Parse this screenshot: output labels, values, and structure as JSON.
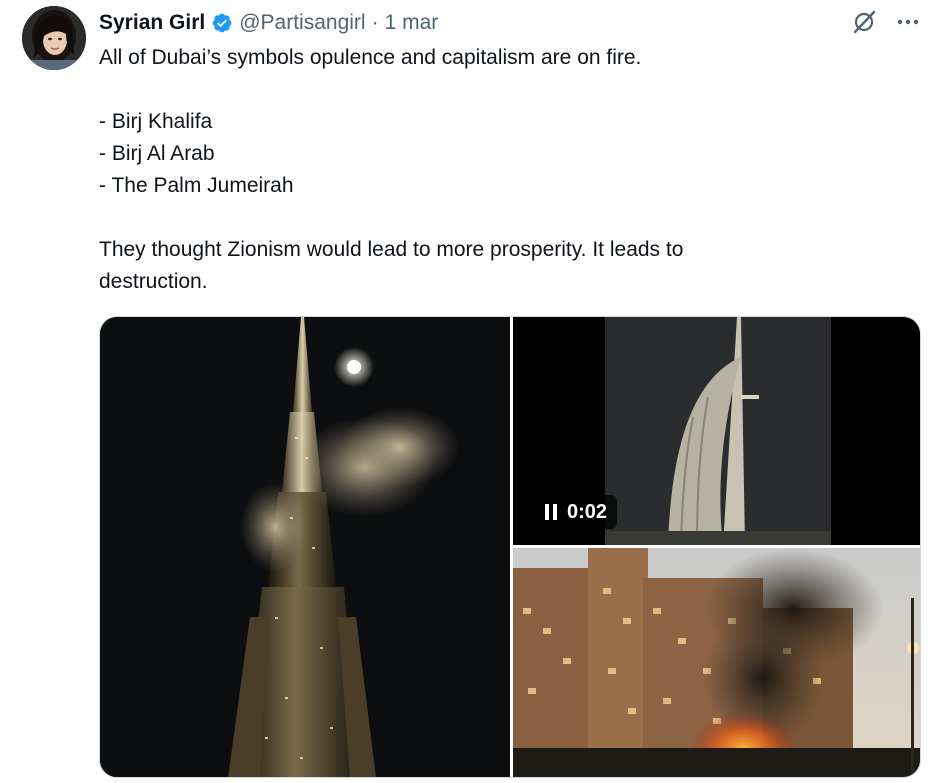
{
  "author": {
    "display_name": "Syrian Girl",
    "handle": "@Partisangirl",
    "separator": "·",
    "date": "1 mar",
    "verified": true,
    "verified_color": "#1d9bf0"
  },
  "header_actions": {
    "grok_icon": "grok-icon",
    "more_icon": "more-dots-icon"
  },
  "tweet": {
    "text": "All of Dubai’s symbols opulence and capitalism are on fire.\n\n- Birj Khalifa\n- Birj Al Arab\n- The Palm Jumeirah\n\nThey thought Zionism would lead to more prosperity. It leads to\ndestruction."
  },
  "media": {
    "video_duration": "0:02",
    "video_state_icon": "pause-icon"
  },
  "colors": {
    "text_primary": "#0f1419",
    "text_secondary": "#536471",
    "border": "#cfd9de"
  }
}
